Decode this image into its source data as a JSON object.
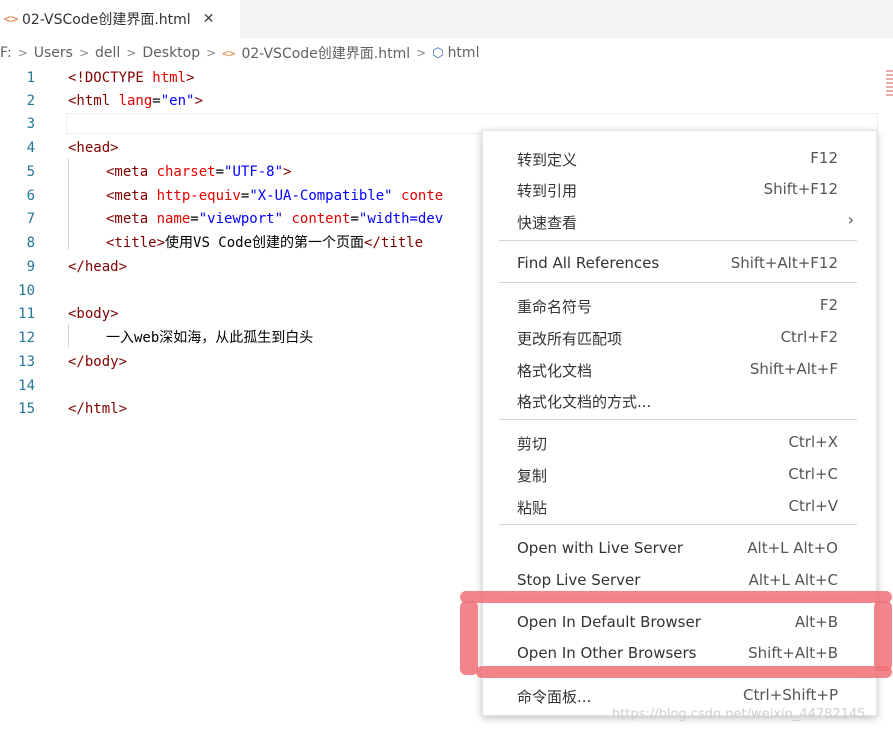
{
  "tab": {
    "icon": "<>",
    "title": "02-VSCode创建界面.html",
    "close": "✕"
  },
  "breadcrumb": {
    "items": [
      "F:",
      "Users",
      "dell",
      "Desktop",
      "02-VSCode创建界面.html",
      "html"
    ]
  },
  "editor": {
    "line_numbers": [
      "1",
      "2",
      "3",
      "4",
      "5",
      "6",
      "7",
      "8",
      "9",
      "10",
      "11",
      "12",
      "13",
      "14",
      "15"
    ]
  },
  "code": {
    "l1": {
      "a": "<!DOCTYPE ",
      "b": "html",
      "c": ">"
    },
    "l2": {
      "a": "<html ",
      "b": "lang",
      "c": "=",
      "d": "\"en\"",
      "e": ">"
    },
    "l4": {
      "a": "<head>"
    },
    "l5": {
      "a": "<meta ",
      "b": "charset",
      "c": "=",
      "d": "\"UTF-8\"",
      "e": ">"
    },
    "l6": {
      "a": "<meta ",
      "b": "http-equiv",
      "c": "=",
      "d": "\"X-UA-Compatible\"",
      "e": " ",
      "f": "conte"
    },
    "l7": {
      "a": "<meta ",
      "b": "name",
      "c": "=",
      "d": "\"viewport\"",
      "e": " ",
      "f": "content",
      "g": "=",
      "h": "\"width=dev"
    },
    "l8": {
      "a": "<title>",
      "b": "使用VS Code创建的第一个页面",
      "c": "</title"
    },
    "l9": {
      "a": "</head>"
    },
    "l11": {
      "a": "<body>"
    },
    "l12": {
      "a": "一入web深如海，从此孤生到白头"
    },
    "l13": {
      "a": "</body>"
    },
    "l15": {
      "a": "</html>"
    }
  },
  "context_menu": {
    "items": [
      {
        "label": "转到定义",
        "shortcut": "F12"
      },
      {
        "label": "转到引用",
        "shortcut": "Shift+F12"
      },
      {
        "label": "快速查看",
        "shortcut": ""
      },
      {
        "label": "Find All References",
        "shortcut": "Shift+Alt+F12"
      },
      {
        "label": "重命名符号",
        "shortcut": "F2"
      },
      {
        "label": "更改所有匹配项",
        "shortcut": "Ctrl+F2"
      },
      {
        "label": "格式化文档",
        "shortcut": "Shift+Alt+F"
      },
      {
        "label": "格式化文档的方式...",
        "shortcut": ""
      },
      {
        "label": "剪切",
        "shortcut": "Ctrl+X"
      },
      {
        "label": "复制",
        "shortcut": "Ctrl+C"
      },
      {
        "label": "粘贴",
        "shortcut": "Ctrl+V"
      },
      {
        "label": "Open with Live Server",
        "shortcut": "Alt+L Alt+O"
      },
      {
        "label": "Stop Live Server",
        "shortcut": "Alt+L Alt+C"
      },
      {
        "label": "Open In Default Browser",
        "shortcut": "Alt+B"
      },
      {
        "label": "Open In Other Browsers",
        "shortcut": "Shift+Alt+B"
      },
      {
        "label": "命令面板...",
        "shortcut": "Ctrl+Shift+P"
      }
    ],
    "submenu_arrow": "›"
  },
  "watermark": "https://blog.csdn.net/weixin_44782145",
  "colors": {
    "tag": "#800000",
    "attribute": "#e50000",
    "value": "#0000ff",
    "line_number": "#237893",
    "highlight_annotation": "#f07078"
  }
}
